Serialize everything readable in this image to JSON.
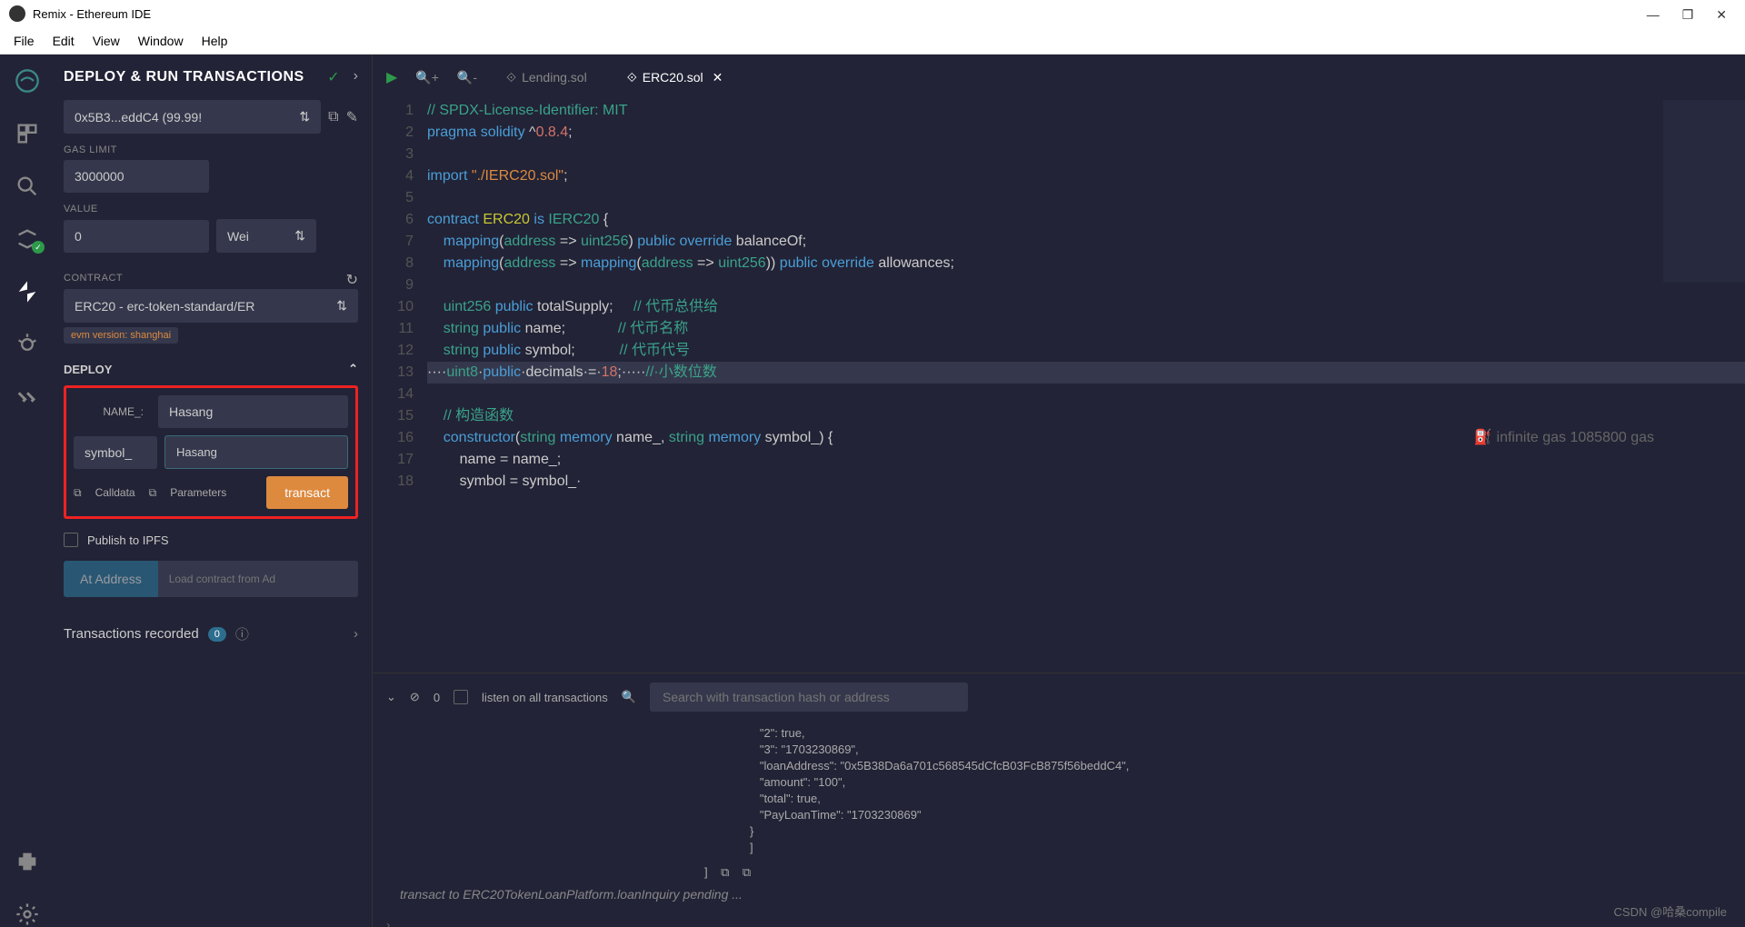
{
  "window": {
    "title": "Remix - Ethereum IDE",
    "minimize": "—",
    "maximize": "❐",
    "close": "✕"
  },
  "menu": [
    "File",
    "Edit",
    "View",
    "Window",
    "Help"
  ],
  "panel": {
    "title": "DEPLOY & RUN TRANSACTIONS",
    "account": "0x5B3...eddC4 (99.99!",
    "gas_limit_label": "GAS LIMIT",
    "gas_limit": "3000000",
    "value_label": "VALUE",
    "value": "0",
    "value_unit": "Wei",
    "contract_label": "CONTRACT",
    "contract": "ERC20 - erc-token-standard/ER",
    "evm_version": "evm version: shanghai",
    "deploy_label": "DEPLOY",
    "param_name_label": "NAME_:",
    "param_name_value": "Hasang",
    "symbol_btn": "symbol_",
    "symbol_value": "Hasang",
    "calldata": "Calldata",
    "parameters": "Parameters",
    "transact": "transact",
    "publish_ipfs": "Publish to IPFS",
    "at_address": "At Address",
    "at_address_placeholder": "Load contract from Ad",
    "tx_recorded": "Transactions recorded",
    "tx_count": "0"
  },
  "tabs": [
    {
      "name": "Lending.sol",
      "active": false
    },
    {
      "name": "ERC20.sol",
      "active": true
    }
  ],
  "code_lines": [
    "// SPDX-License-Identifier: MIT",
    "pragma solidity ^0.8.4;",
    "",
    "import \"./IERC20.sol\";",
    "",
    "contract ERC20 is IERC20 {",
    "    mapping(address => uint256) public override balanceOf;",
    "    mapping(address => mapping(address => uint256)) public override allowances;",
    "",
    "    uint256 public totalSupply;     // 代币总供给",
    "    string public name;             // 代币名称",
    "    string public symbol;           // 代币代号",
    "    uint8 public decimals = 18;     // 小数位数",
    "",
    "    // 构造函数",
    "    constructor(string memory name_, string memory symbol_) {",
    "        name = name_;",
    "        symbol = symbol_;"
  ],
  "gas_hint": "infinite gas 1085800 gas",
  "terminal": {
    "listen_label": "listen on all transactions",
    "zero": "0",
    "search_placeholder": "Search with transaction hash or address",
    "json_output": "   \"2\": true,\n   \"3\": \"1703230869\",\n   \"loanAddress\": \"0x5B38Da6a701c568545dCfcB03FcB875f56beddC4\",\n   \"amount\": \"100\",\n   \"total\": true,\n   \"PayLoanTime\": \"1703230869\"\n}\n]",
    "status": "transact to ERC20TokenLoanPlatform.loanInquiry pending ..."
  },
  "watermark": "CSDN @哈桑compile"
}
